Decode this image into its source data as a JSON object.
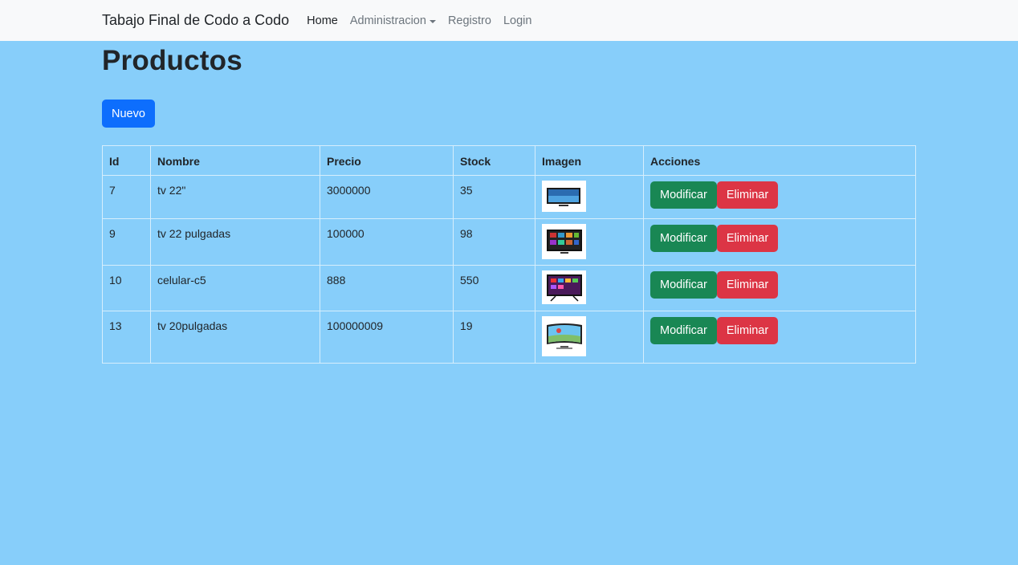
{
  "navbar": {
    "brand": "Tabajo Final de Codo a Codo",
    "links": [
      "Home",
      "Administracion",
      "Registro",
      "Login"
    ]
  },
  "page": {
    "title": "Productos",
    "new_button": "Nuevo"
  },
  "table": {
    "headers": [
      "Id",
      "Nombre",
      "Precio",
      "Stock",
      "Imagen",
      "Acciones"
    ],
    "rows": [
      {
        "id": "7",
        "nombre": "tv 22\"",
        "precio": "3000000",
        "stock": "35"
      },
      {
        "id": "9",
        "nombre": "tv 22 pulgadas",
        "precio": "100000",
        "stock": "98"
      },
      {
        "id": "10",
        "nombre": "celular-c5",
        "precio": "888",
        "stock": "550"
      },
      {
        "id": "13",
        "nombre": "tv 20pulgadas",
        "precio": "100000009",
        "stock": "19"
      }
    ],
    "modify_label": "Modificar",
    "delete_label": "Eliminar"
  },
  "colors": {
    "background": "#87cefa",
    "primary": "#0d6efd",
    "success": "#198754",
    "danger": "#dc3545"
  }
}
